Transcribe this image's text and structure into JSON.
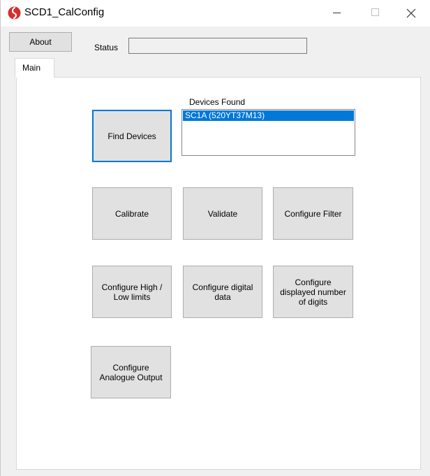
{
  "window": {
    "title": "SCD1_CalConfig"
  },
  "toolbar": {
    "about_label": "About",
    "status_label": "Status",
    "status_value": ""
  },
  "tabs": [
    {
      "label": "Main",
      "selected": true
    }
  ],
  "main": {
    "devices_found_label": "Devices Found",
    "devices": [
      {
        "label": "SC1A (520YT37M13)",
        "selected": true
      }
    ],
    "buttons": {
      "find_devices": "Find Devices",
      "calibrate": "Calibrate",
      "validate": "Validate",
      "configure_filter": "Configure Filter",
      "configure_high_low": "Configure High / Low limits",
      "configure_digital": "Configure digital data",
      "configure_digits": "Configure displayed number of digits",
      "configure_analogue": "Configure Analogue Output"
    }
  },
  "colors": {
    "accent": "#0078d7",
    "app_icon": "#d32f2f",
    "window_bg": "#f0f0f0",
    "button_face": "#e1e1e1"
  },
  "icons": {
    "app": "app-logo-icon",
    "minimize": "minimize-icon",
    "maximize": "maximize-icon",
    "close": "close-icon"
  }
}
